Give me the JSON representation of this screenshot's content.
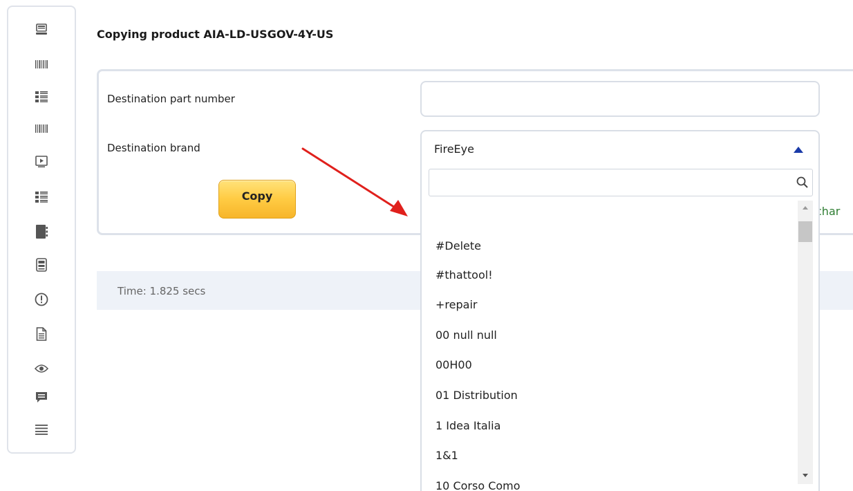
{
  "title": "Copying product AIA-LD-USGOV-4Y-US",
  "sidebar": {
    "icons": [
      "monitor-icon",
      "barcode-icon",
      "list-view-icon",
      "barcode-icon",
      "play-screen-icon",
      "list-view-icon",
      "notebook-icon",
      "archive-icon",
      "alert-circle-icon",
      "document-icon",
      "eye-icon",
      "chat-bubble-icon",
      "menu-lines-icon"
    ]
  },
  "form": {
    "destination_part_number_label": "Destination part number",
    "destination_part_number_value": "",
    "destination_brand_label": "Destination brand",
    "copy_button_label": "Copy",
    "partial_green_text": "char"
  },
  "dropdown": {
    "selected": "FireEye",
    "search_value": "",
    "options": [
      "",
      "#Delete",
      "#thattool!",
      "+repair",
      "00 null null",
      "00H00",
      "01 Distribution",
      "1 Idea Italia",
      "1&1",
      "10 Corso Como"
    ]
  },
  "status": {
    "time": "Time: 1.825 secs"
  },
  "colors": {
    "accent_arrow": "#e0201c",
    "copy_button": "#ffcc44",
    "dropdown_arrow": "#1a3aa8",
    "green_text": "#2e7d32"
  }
}
